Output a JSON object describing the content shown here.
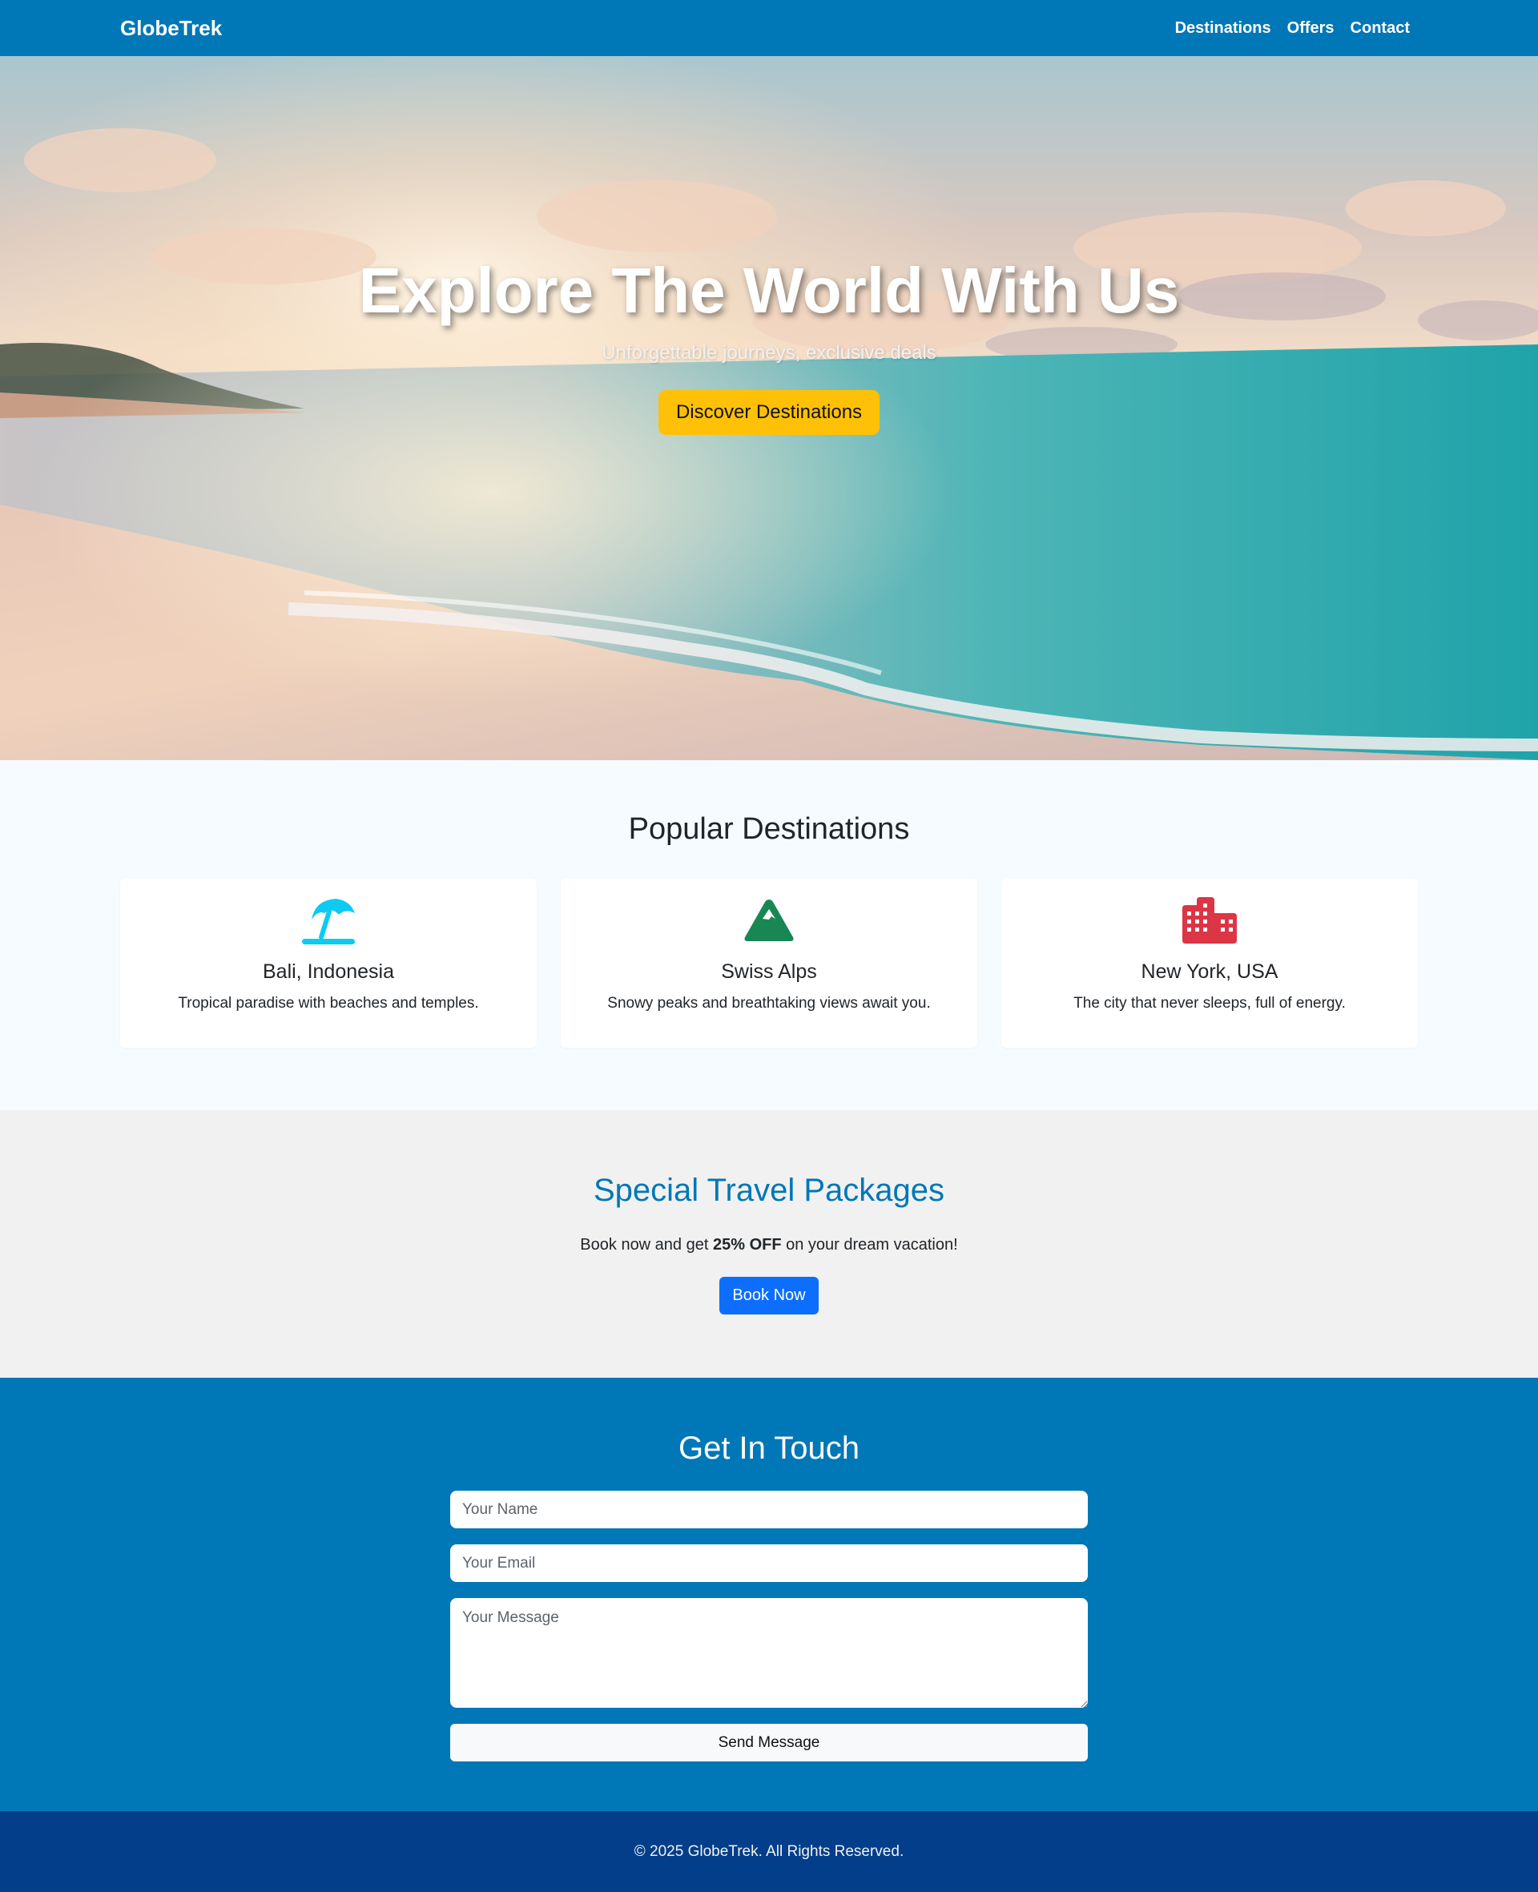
{
  "nav": {
    "brand": "GlobeTrek",
    "links": [
      "Destinations",
      "Offers",
      "Contact"
    ]
  },
  "hero": {
    "title": "Explore The World With Us",
    "subtitle": "Unforgettable journeys, exclusive deals",
    "cta": "Discover Destinations"
  },
  "destinations": {
    "title": "Popular Destinations",
    "cards": [
      {
        "icon": "beach-umbrella-icon",
        "icon_color": "#0dcaf0",
        "title": "Bali, Indonesia",
        "text": "Tropical paradise with beaches and temples."
      },
      {
        "icon": "mountain-icon",
        "icon_color": "#198754",
        "title": "Swiss Alps",
        "text": "Snowy peaks and breathtaking views await you."
      },
      {
        "icon": "city-buildings-icon",
        "icon_color": "#dc3545",
        "title": "New York, USA",
        "text": "The city that never sleeps, full of energy."
      }
    ]
  },
  "offers": {
    "title": "Special Travel Packages",
    "text_before": "Book now and get ",
    "text_bold": "25% OFF",
    "text_after": " on your dream vacation!",
    "button": "Book Now"
  },
  "contact": {
    "title": "Get In Touch",
    "name_placeholder": "Your Name",
    "email_placeholder": "Your Email",
    "message_placeholder": "Your Message",
    "button": "Send Message"
  },
  "footer": {
    "text": "© 2025 GlobeTrek. All Rights Reserved."
  },
  "colors": {
    "primary": "#0077b6",
    "accent": "#ffc107",
    "button_blue": "#0d6efd",
    "footer": "#023e8a"
  }
}
